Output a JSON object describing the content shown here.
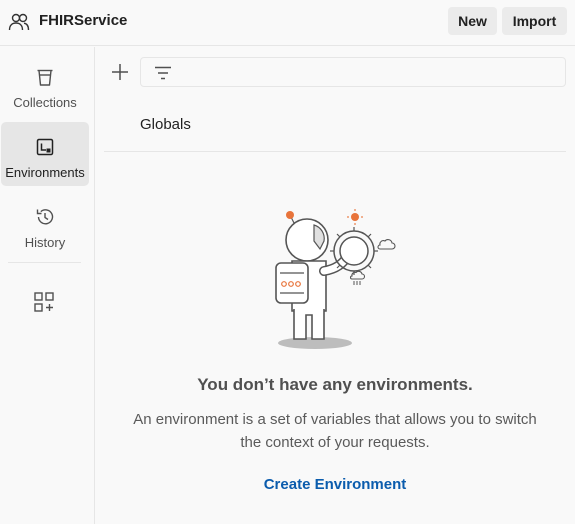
{
  "workspace": {
    "name": "FHIRService",
    "icon": "team-icon"
  },
  "header": {
    "new_label": "New",
    "import_label": "Import"
  },
  "sidebar": {
    "items": [
      {
        "label": "Collections",
        "icon": "trash-bin-icon",
        "active": false
      },
      {
        "label": "Environments",
        "icon": "environment-icon",
        "active": true
      },
      {
        "label": "History",
        "icon": "history-icon",
        "active": false
      }
    ],
    "extra_icon": "add-widget-icon"
  },
  "toolbar": {
    "add_icon": "plus-icon",
    "filter_icon": "filter-icon",
    "filter_value": ""
  },
  "list": {
    "globals_label": "Globals"
  },
  "empty_state": {
    "title": "You don’t have any environments.",
    "description_line1": "An environment is a set of variables that allows you to switch",
    "description_line2": "the context of your requests.",
    "action_label": "Create Environment",
    "illustration": "astronaut-turning-dial"
  },
  "colors": {
    "accent_link": "#0b5cad",
    "active_item_bg": "#e6e6e6",
    "illustration_orange": "#e8743b"
  }
}
